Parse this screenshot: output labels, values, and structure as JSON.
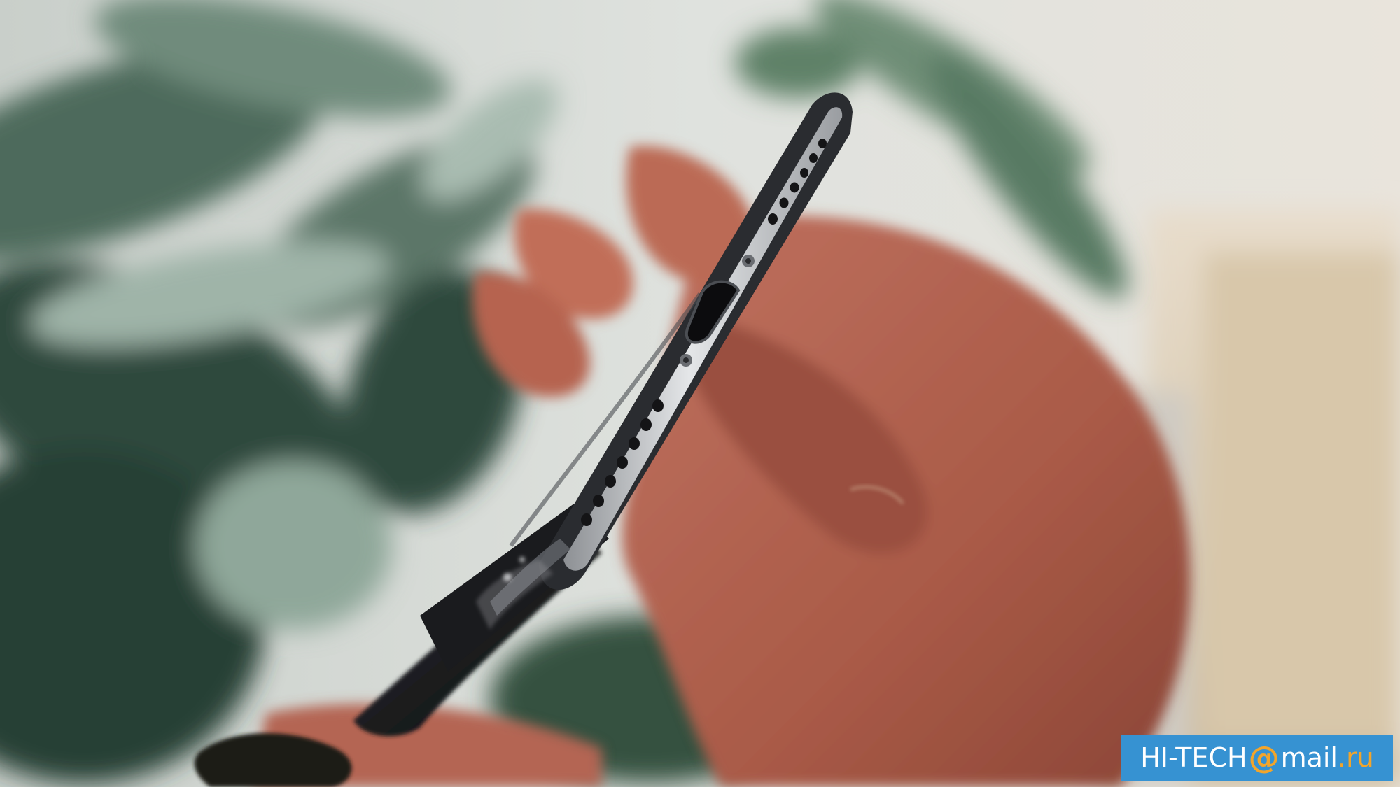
{
  "photo": {
    "subject": "phone-bottom-edge",
    "colors": {
      "background_light": "#dfe2de",
      "leaf_dark": "#2f4a3e",
      "leaf_mid": "#56735f",
      "leaf_light": "#8fa79a",
      "skin": "#b9644f",
      "skin_dark": "#8f4a3a",
      "phone_black": "#1c1d20",
      "phone_edge": "#c7c9cc",
      "wall_warm": "#e7d7bf"
    }
  },
  "watermark": {
    "prefix": "HI-TECH",
    "at": "@",
    "domain": "mail",
    "tld": ".ru",
    "bg_color": "#3692d2",
    "accent_color": "#f2a52b"
  }
}
